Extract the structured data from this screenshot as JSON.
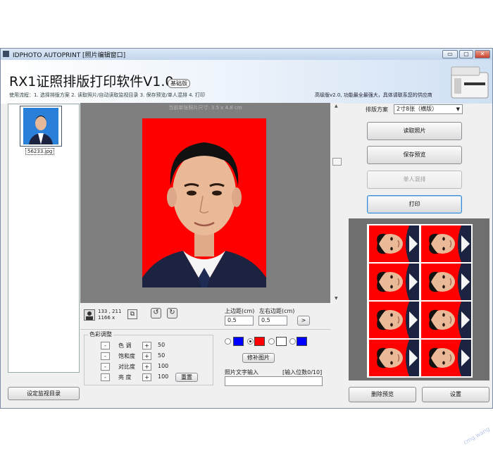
{
  "window": {
    "title": "IDPHOTO AUTOPRINT [照片编辑窗口]",
    "controls": {
      "minimize": "▭",
      "maximize": "▢",
      "close": "✕"
    }
  },
  "header": {
    "app_title": "RX1证照排版打印软件V1.0",
    "edition": "基础版",
    "steps": "使用流程：1. 选择排版方案   2. 读取照片/自动读取监视目录   3. 保存预览/单人混排   4. 打印",
    "ad_text": "高级版v2.0, 功能最全最强大，具体请联系您的供应商"
  },
  "left_panel": {
    "thumbnail_caption": "56233.jpg",
    "set_dir_button": "设定监视目录"
  },
  "canvas": {
    "caption": "当前单张照片尺寸: 3.5 x 4.8 cm",
    "photo_bg_color": "#ff0000"
  },
  "info": {
    "coords": "133 , 211",
    "size": "1166 x"
  },
  "margins": {
    "top_label": "上边距(cm)",
    "left_label": "左右边距(cm)",
    "top_value": "0.5",
    "left_value": "0.5",
    "apply_button": ">"
  },
  "color_adjust": {
    "title": "色彩调整",
    "rows": [
      {
        "label": "色 调",
        "value": "50"
      },
      {
        "label": "饱和度",
        "value": "50"
      },
      {
        "label": "对比度",
        "value": "100"
      },
      {
        "label": "亮 度",
        "value": "100"
      }
    ],
    "minus": "-",
    "plus": "+",
    "reset_button": "重置"
  },
  "bg_colors": {
    "swatches": [
      "#0000ff",
      "#ff0000",
      "#ffffff",
      "#0000ff"
    ],
    "selected_index": 1
  },
  "patch_button": "修补图片",
  "text_input": {
    "label": "照片文字输入",
    "counter": "[输入位数0/10]",
    "value": ""
  },
  "right_panel": {
    "layout_label": "排版方案",
    "layout_value": "2寸8张（横版）",
    "read_photo": "读取照片",
    "save_preview": "保存预览",
    "single_mix": "单人混排",
    "print": "打印",
    "delete_preview": "删除预览",
    "settings": "设置"
  },
  "watermark": "cmg.wang"
}
